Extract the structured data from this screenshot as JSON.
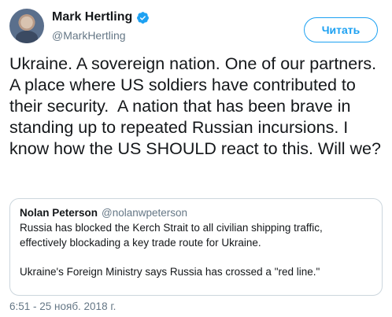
{
  "author": {
    "name": "Mark Hertling",
    "handle": "@MarkHertling",
    "verified": true,
    "avatar_icon": "avatar-photo"
  },
  "follow_button": {
    "label": "Читать"
  },
  "tweet": {
    "text": "Ukraine. A sovereign nation. One of our partners. A place where US soldiers have contributed to their security.  A nation that has been brave in standing up to repeated Russian incursions. I know how the US SHOULD react to this. Will we?"
  },
  "quoted_tweet": {
    "name": "Nolan Peterson",
    "handle": "@nolanwpeterson",
    "text": "Russia has blocked the Kerch Strait to all civilian shipping traffic, effectively blockading a key trade route for Ukraine.\n\nUkraine's Foreign Ministry says Russia has crossed a \"red line.\""
  },
  "timestamp": "6:51 - 25 нояб. 2018 г.",
  "colors": {
    "accent": "#1da1f2",
    "text": "#14171a",
    "secondary_text": "#657786",
    "border": "#ccd6dd"
  }
}
